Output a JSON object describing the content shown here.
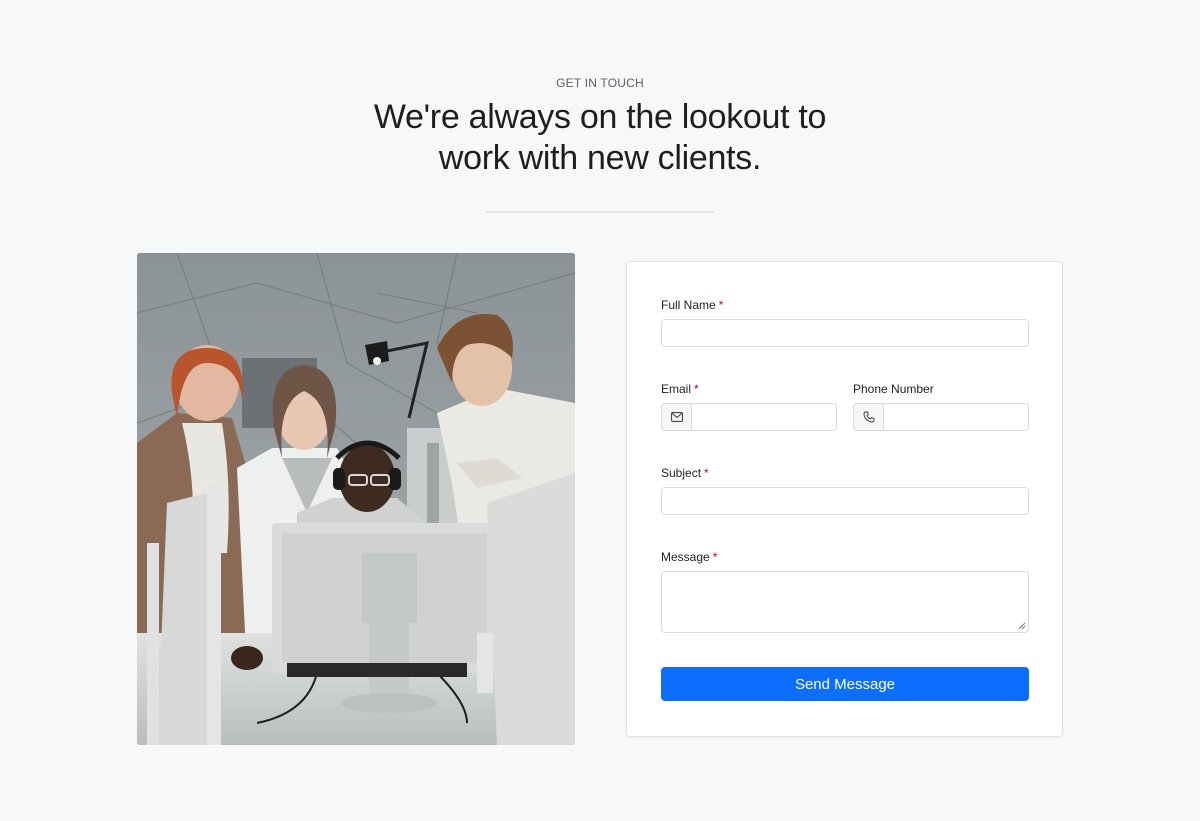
{
  "header": {
    "eyebrow": "GET IN TOUCH",
    "headline_line1": "We're always on the lookout to",
    "headline_line2": "work with new clients."
  },
  "image": {
    "icon": "team-office-photo"
  },
  "form": {
    "full_name": {
      "label": "Full Name",
      "required_mark": "*",
      "value": ""
    },
    "email": {
      "label": "Email",
      "required_mark": "*",
      "value": "",
      "icon": "envelope-icon"
    },
    "phone": {
      "label": "Phone Number",
      "value": "",
      "icon": "phone-icon"
    },
    "subject": {
      "label": "Subject",
      "required_mark": "*",
      "value": ""
    },
    "message": {
      "label": "Message",
      "required_mark": "*",
      "value": ""
    },
    "submit_label": "Send Message"
  },
  "colors": {
    "background": "#f7f8fa",
    "primary": "#0d6efd",
    "required": "#d0021b"
  }
}
